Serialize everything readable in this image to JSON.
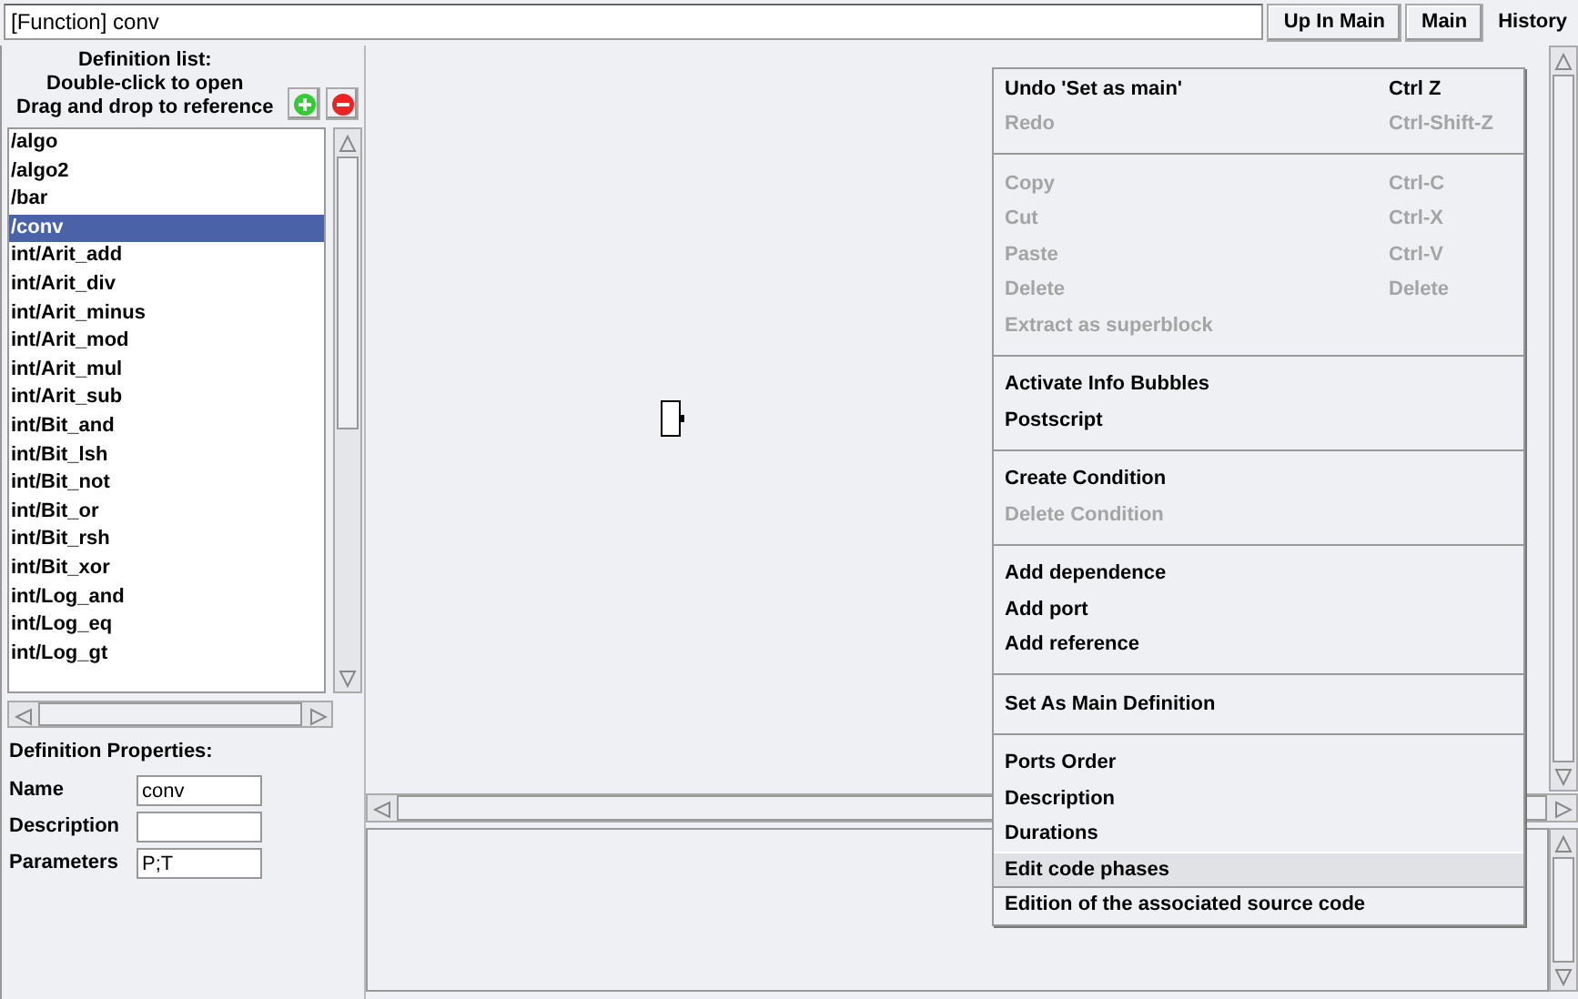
{
  "path_field": {
    "value": "[Function] conv"
  },
  "toolbar_buttons": [
    {
      "label": "Up In Main",
      "flat": false
    },
    {
      "label": "Main",
      "flat": false
    },
    {
      "label": "History",
      "flat": true
    }
  ],
  "definition_list": {
    "header": [
      "Definition list:",
      "Double-click to open",
      "Drag and drop to reference"
    ],
    "items": [
      {
        "label": "/algo",
        "selected": false
      },
      {
        "label": "/algo2",
        "selected": false
      },
      {
        "label": "/bar",
        "selected": false
      },
      {
        "label": "/conv",
        "selected": true
      },
      {
        "label": "int/Arit_add",
        "selected": false
      },
      {
        "label": "int/Arit_div",
        "selected": false
      },
      {
        "label": "int/Arit_minus",
        "selected": false
      },
      {
        "label": "int/Arit_mod",
        "selected": false
      },
      {
        "label": "int/Arit_mul",
        "selected": false
      },
      {
        "label": "int/Arit_sub",
        "selected": false
      },
      {
        "label": "int/Bit_and",
        "selected": false
      },
      {
        "label": "int/Bit_lsh",
        "selected": false
      },
      {
        "label": "int/Bit_not",
        "selected": false
      },
      {
        "label": "int/Bit_or",
        "selected": false
      },
      {
        "label": "int/Bit_rsh",
        "selected": false
      },
      {
        "label": "int/Bit_xor",
        "selected": false
      },
      {
        "label": "int/Log_and",
        "selected": false
      },
      {
        "label": "int/Log_eq",
        "selected": false
      },
      {
        "label": "int/Log_gt",
        "selected": false
      }
    ]
  },
  "properties": {
    "title": "Definition Properties:",
    "fields": [
      {
        "label": "Name",
        "value": "conv"
      },
      {
        "label": "Description"
      },
      {
        "label": "Parameters",
        "value": "P;T"
      }
    ]
  },
  "context_menu": [
    {
      "kind": "item",
      "label": "Undo 'Set as main'",
      "shortcut": "Ctrl Z",
      "disabled": false,
      "hovered": false
    },
    {
      "kind": "item",
      "label": "Redo",
      "shortcut": "Ctrl-Shift-Z",
      "disabled": true,
      "hovered": false
    },
    {
      "kind": "separator"
    },
    {
      "kind": "item",
      "label": "Copy",
      "shortcut": "Ctrl-C",
      "disabled": true,
      "hovered": false
    },
    {
      "kind": "item",
      "label": "Cut",
      "shortcut": "Ctrl-X",
      "disabled": true,
      "hovered": false
    },
    {
      "kind": "item",
      "label": "Paste",
      "shortcut": "Ctrl-V",
      "disabled": true,
      "hovered": false
    },
    {
      "kind": "item",
      "label": "Delete",
      "shortcut": "Delete",
      "disabled": true,
      "hovered": false
    },
    {
      "kind": "item",
      "label": "Extract as superblock",
      "disabled": true,
      "hovered": false
    },
    {
      "kind": "separator"
    },
    {
      "kind": "item",
      "label": "Activate Info Bubbles",
      "disabled": false,
      "hovered": false
    },
    {
      "kind": "item",
      "label": "Postscript",
      "disabled": false,
      "hovered": false
    },
    {
      "kind": "separator"
    },
    {
      "kind": "item",
      "label": "Create Condition",
      "disabled": false,
      "hovered": false
    },
    {
      "kind": "item",
      "label": "Delete Condition",
      "disabled": true,
      "hovered": false
    },
    {
      "kind": "separator"
    },
    {
      "kind": "item",
      "label": "Add dependence",
      "disabled": false,
      "hovered": false
    },
    {
      "kind": "item",
      "label": "Add port",
      "disabled": false,
      "hovered": false
    },
    {
      "kind": "item",
      "label": "Add reference",
      "disabled": false,
      "hovered": false
    },
    {
      "kind": "separator"
    },
    {
      "kind": "item",
      "label": "Set As Main Definition",
      "disabled": false,
      "hovered": false
    },
    {
      "kind": "separator"
    },
    {
      "kind": "item",
      "label": "Ports Order",
      "disabled": false,
      "hovered": false
    },
    {
      "kind": "item",
      "label": "Description",
      "disabled": false,
      "hovered": false
    },
    {
      "kind": "item",
      "label": "Durations",
      "disabled": false,
      "hovered": false
    },
    {
      "kind": "item",
      "label": "Edit code phases",
      "disabled": false,
      "hovered": true
    },
    {
      "kind": "item",
      "label": "Edition of the associated source code",
      "disabled": false,
      "hovered": false
    }
  ]
}
